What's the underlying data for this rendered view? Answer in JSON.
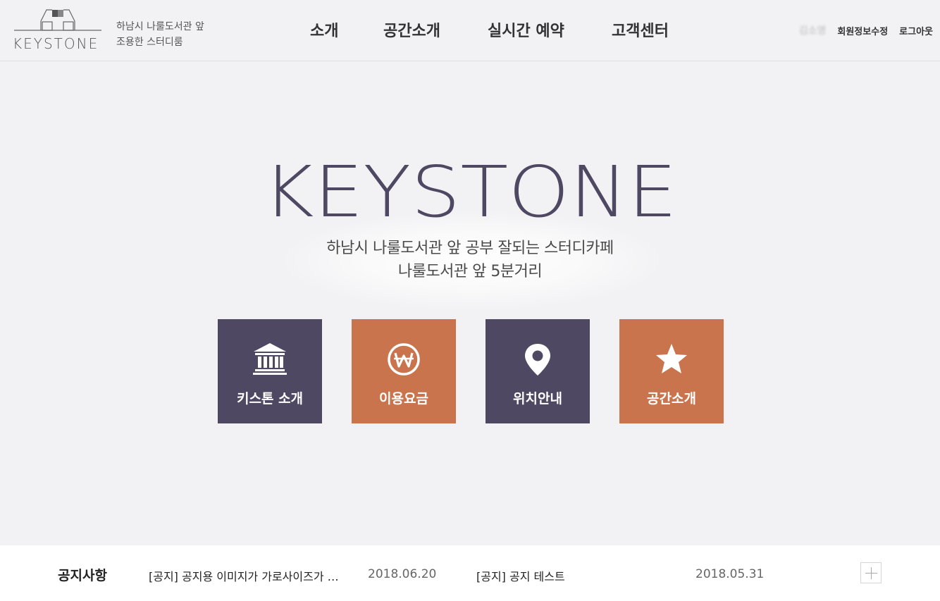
{
  "header": {
    "logo_text": "KEYSTONE",
    "tagline_line1": "하남시 나룰도서관 앞",
    "tagline_line2": "조용한 스터디룸",
    "nav": [
      "소개",
      "공간소개",
      "실시간 예약",
      "고객센터"
    ],
    "user_name": "김소영",
    "edit_profile": "회원정보수정",
    "logout": "로그아웃"
  },
  "hero": {
    "title": "KEYSTONE",
    "subtitle_line1": "하남시 나룰도서관 앞 공부 잘되는 스터디카페",
    "subtitle_line2": "나룰도서관 앞 5분거리"
  },
  "tiles": [
    {
      "label": "키스톤 소개",
      "icon": "bank-icon",
      "color": "#4e4862"
    },
    {
      "label": "이용요금",
      "icon": "won-icon",
      "color": "#c9744c"
    },
    {
      "label": "위치안내",
      "icon": "map-pin-icon",
      "color": "#4e4862"
    },
    {
      "label": "공간소개",
      "icon": "star-icon",
      "color": "#c9744c"
    }
  ],
  "notice": {
    "title": "공지사항",
    "items": [
      {
        "text": "[공지] 공지용 이미지가 가로사이즈가 …",
        "date": "2018.06.20"
      },
      {
        "text": "[공지] 공지 테스트",
        "date": "2018.05.31"
      }
    ],
    "more_icon": "plus-icon"
  }
}
